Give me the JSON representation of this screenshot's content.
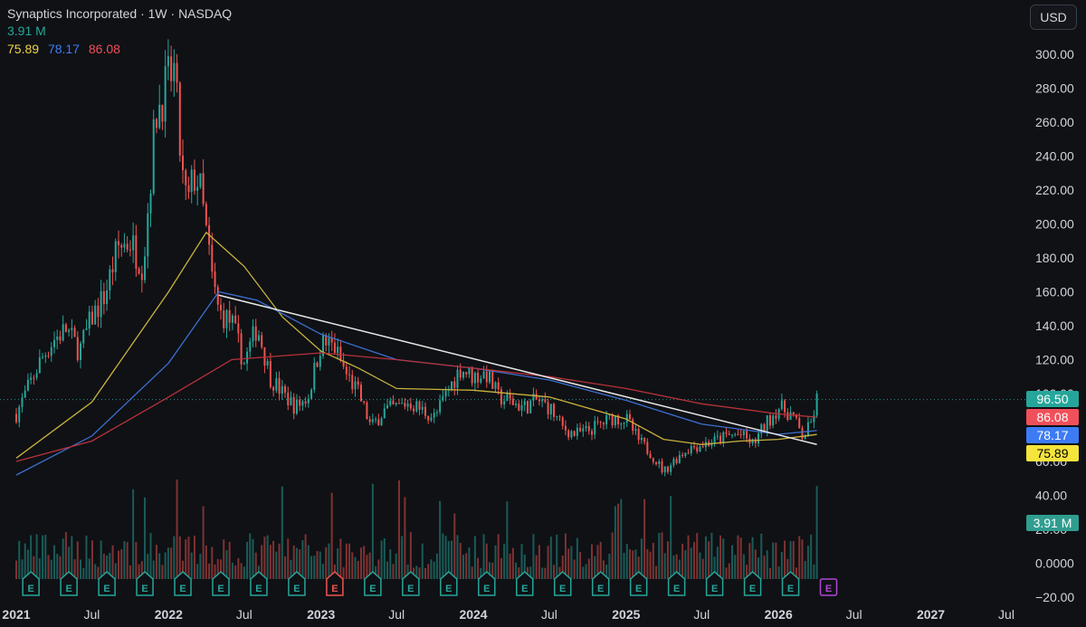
{
  "header": {
    "title": "Synaptics Incorporated · 1W · NASDAQ",
    "volume": "3.91 M",
    "ma_values": [
      {
        "label": "75.89",
        "color": "#f0d347"
      },
      {
        "label": "78.17",
        "color": "#3d7bf5"
      },
      {
        "label": "86.08",
        "color": "#f0505a"
      }
    ]
  },
  "currency_button": "USD",
  "badges": {
    "price": {
      "label": "96.50",
      "bg": "#26a69a",
      "fg": "#ffffff"
    },
    "ma_red": {
      "label": "86.08",
      "bg": "#f0505a",
      "fg": "#ffffff"
    },
    "ma_blue": {
      "label": "78.17",
      "bg": "#3d7bf5",
      "fg": "#ffffff"
    },
    "ma_yellow": {
      "label": "75.89",
      "bg": "#f5e43c",
      "fg": "#000000"
    },
    "volume": {
      "label": "3.91 M",
      "bg": "#2f9d8f",
      "fg": "#ffffff"
    }
  },
  "colors": {
    "up": "#26a69a",
    "down": "#ef5350",
    "ma_yellow": "#c9b23c",
    "ma_blue": "#3d6fd1",
    "ma_red": "#b8323a",
    "trendline": "#e8e8e8",
    "axis_text": "#d1d4dc"
  },
  "chart_data": {
    "type": "candlestick",
    "title": "Synaptics Incorporated · 1W · NASDAQ",
    "y_ticks": [
      "300.00",
      "280.00",
      "260.00",
      "240.00",
      "220.00",
      "200.00",
      "180.00",
      "160.00",
      "140.00",
      "120.00",
      "100.00",
      "60.00",
      "40.00",
      "20.00",
      "0.0000",
      "−20.00"
    ],
    "y_tick_values": [
      300,
      280,
      260,
      240,
      220,
      200,
      180,
      160,
      140,
      120,
      100,
      60,
      40,
      20,
      0,
      -20
    ],
    "ylim": [
      -20,
      300
    ],
    "x_ticks": [
      "2021",
      "Jul",
      "2022",
      "Jul",
      "2023",
      "Jul",
      "2024",
      "Jul",
      "2025",
      "Jul",
      "2026",
      "Jul",
      "2027",
      "Jul"
    ],
    "x_tick_dates": [
      "2021-01-01",
      "2021-07-01",
      "2022-01-01",
      "2022-07-01",
      "2023-01-01",
      "2023-07-01",
      "2024-01-01",
      "2024-07-01",
      "2025-01-01",
      "2025-07-01",
      "2026-01-01",
      "2026-07-01",
      "2027-01-01",
      "2027-07-01"
    ],
    "bold_x_ticks": [
      "2021",
      "2022",
      "2023",
      "2024",
      "2025",
      "2026",
      "2027"
    ],
    "price_path": [
      [
        "2021-01-01",
        88
      ],
      [
        "2021-02-01",
        105
      ],
      [
        "2021-03-01",
        120
      ],
      [
        "2021-04-01",
        132
      ],
      [
        "2021-05-01",
        138
      ],
      [
        "2021-06-01",
        125
      ],
      [
        "2021-07-01",
        145
      ],
      [
        "2021-08-01",
        158
      ],
      [
        "2021-09-01",
        186
      ],
      [
        "2021-10-01",
        190
      ],
      [
        "2021-11-01",
        175
      ],
      [
        "2021-12-01",
        265
      ],
      [
        "2022-01-01",
        285
      ],
      [
        "2022-01-15",
        290
      ],
      [
        "2022-02-01",
        230
      ],
      [
        "2022-02-15",
        210
      ],
      [
        "2022-03-01",
        228
      ],
      [
        "2022-03-15",
        225
      ],
      [
        "2022-04-01",
        195
      ],
      [
        "2022-04-15",
        168
      ],
      [
        "2022-05-01",
        148
      ],
      [
        "2022-06-01",
        142
      ],
      [
        "2022-07-01",
        118
      ],
      [
        "2022-08-01",
        140
      ],
      [
        "2022-09-01",
        110
      ],
      [
        "2022-10-01",
        100
      ],
      [
        "2022-11-01",
        92
      ],
      [
        "2022-12-01",
        98
      ],
      [
        "2023-01-01",
        130
      ],
      [
        "2023-02-01",
        128
      ],
      [
        "2023-03-01",
        112
      ],
      [
        "2023-04-01",
        100
      ],
      [
        "2023-05-01",
        80
      ],
      [
        "2023-06-01",
        90
      ],
      [
        "2023-07-01",
        92
      ],
      [
        "2023-08-01",
        95
      ],
      [
        "2023-09-01",
        90
      ],
      [
        "2023-10-01",
        86
      ],
      [
        "2023-11-01",
        102
      ],
      [
        "2023-12-01",
        115
      ],
      [
        "2024-01-01",
        110
      ],
      [
        "2024-02-01",
        112
      ],
      [
        "2024-03-01",
        98
      ],
      [
        "2024-04-01",
        95
      ],
      [
        "2024-05-01",
        92
      ],
      [
        "2024-06-01",
        96
      ],
      [
        "2024-07-01",
        92
      ],
      [
        "2024-08-01",
        80
      ],
      [
        "2024-09-01",
        76
      ],
      [
        "2024-10-01",
        78
      ],
      [
        "2024-11-01",
        82
      ],
      [
        "2024-12-01",
        86
      ],
      [
        "2025-01-01",
        85
      ],
      [
        "2025-02-01",
        72
      ],
      [
        "2025-03-01",
        65
      ],
      [
        "2025-04-01",
        54
      ],
      [
        "2025-05-01",
        62
      ],
      [
        "2025-06-01",
        68
      ],
      [
        "2025-07-01",
        70
      ],
      [
        "2025-08-01",
        72
      ],
      [
        "2025-09-01",
        75
      ],
      [
        "2025-10-01",
        76
      ],
      [
        "2025-11-01",
        70
      ],
      [
        "2025-12-01",
        82
      ],
      [
        "2026-01-01",
        92
      ],
      [
        "2026-02-01",
        88
      ],
      [
        "2026-03-01",
        74
      ],
      [
        "2026-03-20",
        82
      ],
      [
        "2026-04-03",
        96.5
      ]
    ],
    "series": [
      {
        "name": "75.89",
        "color": "#c9b23c",
        "values": [
          [
            "2021-01-01",
            62
          ],
          [
            "2021-07-01",
            95
          ],
          [
            "2022-01-01",
            160
          ],
          [
            "2022-04-01",
            195
          ],
          [
            "2022-07-01",
            175
          ],
          [
            "2022-10-01",
            145
          ],
          [
            "2023-01-01",
            125
          ],
          [
            "2023-04-01",
            115
          ],
          [
            "2023-07-01",
            103
          ],
          [
            "2024-01-01",
            102
          ],
          [
            "2024-07-01",
            98
          ],
          [
            "2025-01-01",
            85
          ],
          [
            "2025-04-01",
            73
          ],
          [
            "2025-07-01",
            70
          ],
          [
            "2025-10-01",
            72
          ],
          [
            "2026-01-01",
            73
          ],
          [
            "2026-04-03",
            75.89
          ]
        ]
      },
      {
        "name": "78.17",
        "color": "#3d6fd1",
        "values": [
          [
            "2021-01-01",
            52
          ],
          [
            "2021-07-01",
            75
          ],
          [
            "2022-01-01",
            118
          ],
          [
            "2022-05-01",
            160
          ],
          [
            "2022-08-01",
            155
          ],
          [
            "2023-01-01",
            135
          ],
          [
            "2023-07-01",
            120
          ],
          [
            "2024-01-01",
            115
          ],
          [
            "2024-07-01",
            108
          ],
          [
            "2025-01-01",
            96
          ],
          [
            "2025-07-01",
            82
          ],
          [
            "2026-01-01",
            76
          ],
          [
            "2026-04-03",
            78.17
          ]
        ]
      },
      {
        "name": "86.08",
        "color": "#b8323a",
        "values": [
          [
            "2021-01-01",
            60
          ],
          [
            "2021-07-01",
            72
          ],
          [
            "2022-01-01",
            98
          ],
          [
            "2022-06-01",
            120
          ],
          [
            "2023-01-01",
            124
          ],
          [
            "2023-07-01",
            120
          ],
          [
            "2024-01-01",
            115
          ],
          [
            "2024-07-01",
            110
          ],
          [
            "2025-01-01",
            103
          ],
          [
            "2025-07-01",
            94
          ],
          [
            "2026-01-01",
            88
          ],
          [
            "2026-04-03",
            86.08
          ]
        ]
      }
    ],
    "trendline": [
      [
        "2022-05-01",
        158
      ],
      [
        "2026-04-03",
        70
      ]
    ],
    "last_price": 96.5,
    "volume_badge": "3.91 M",
    "earnings_markers": [
      {
        "date": "2021-02-05",
        "kind": "E",
        "past": true
      },
      {
        "date": "2021-05-07",
        "kind": "E",
        "past": true
      },
      {
        "date": "2021-08-06",
        "kind": "E",
        "past": true
      },
      {
        "date": "2021-11-05",
        "kind": "E",
        "past": true
      },
      {
        "date": "2022-02-04",
        "kind": "E",
        "past": true
      },
      {
        "date": "2022-05-06",
        "kind": "E",
        "past": true
      },
      {
        "date": "2022-08-05",
        "kind": "E",
        "past": true
      },
      {
        "date": "2022-11-04",
        "kind": "E",
        "past": true
      },
      {
        "date": "2023-02-03",
        "kind": "E",
        "past": true,
        "negative": true
      },
      {
        "date": "2023-05-05",
        "kind": "E",
        "past": true
      },
      {
        "date": "2023-08-04",
        "kind": "E",
        "past": true
      },
      {
        "date": "2023-11-03",
        "kind": "E",
        "past": true
      },
      {
        "date": "2024-02-02",
        "kind": "E",
        "past": true
      },
      {
        "date": "2024-05-03",
        "kind": "E",
        "past": true
      },
      {
        "date": "2024-08-02",
        "kind": "E",
        "past": true
      },
      {
        "date": "2024-11-01",
        "kind": "E",
        "past": true
      },
      {
        "date": "2025-01-31",
        "kind": "E",
        "past": true
      },
      {
        "date": "2025-05-02",
        "kind": "E",
        "past": true
      },
      {
        "date": "2025-08-01",
        "kind": "E",
        "past": true
      },
      {
        "date": "2025-10-31",
        "kind": "E",
        "past": true
      },
      {
        "date": "2026-01-30",
        "kind": "E",
        "past": true
      },
      {
        "date": "2026-05-01",
        "kind": "E",
        "past": false
      }
    ]
  }
}
